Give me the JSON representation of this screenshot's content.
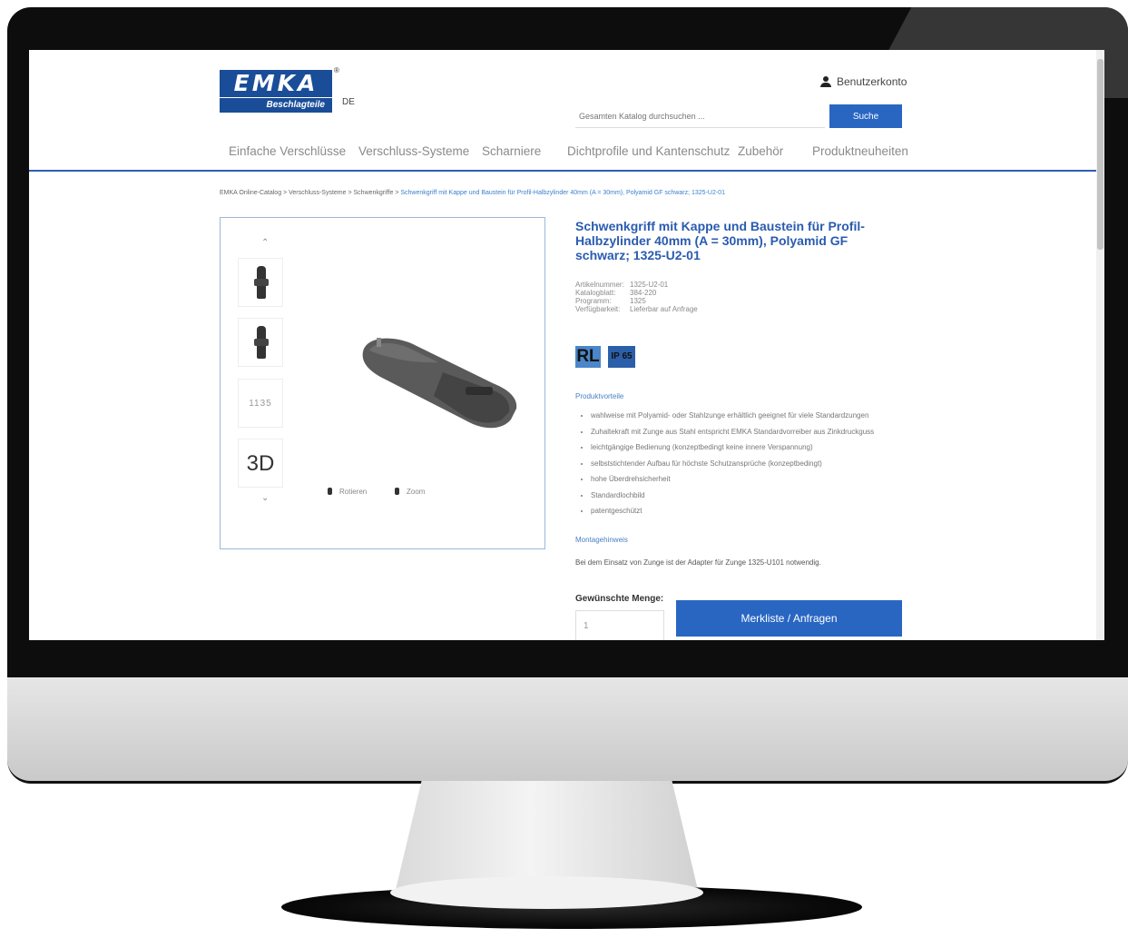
{
  "logo": {
    "brand": "EMKA",
    "tagline": "Beschlagteile",
    "registered": "®"
  },
  "lang": "DE",
  "account": {
    "label": "Benutzerkonto"
  },
  "search": {
    "placeholder": "Gesamten Katalog durchsuchen ...",
    "button": "Suche"
  },
  "nav": [
    "Einfache Verschlüsse",
    "Verschluss-Systeme",
    "Scharniere",
    "Dichtprofile und Kantenschutz",
    "Zubehör",
    "Produktneuheiten"
  ],
  "breadcrumb": {
    "items": [
      "EMKA Online-Catalog",
      "Verschluss-Systeme",
      "Schwenkgriffe"
    ],
    "separator": ">",
    "current": "Schwenkgriff mit Kappe und Baustein für Profil-Halbzylinder 40mm (A = 30mm), Polyamid GF schwarz; 1325-U2-01"
  },
  "gallery": {
    "up_arrow": "⌃",
    "down_arrow": "⌄",
    "thumb_3d": "3D",
    "thumb_dimensions": "1135",
    "rotate_label": "Rotieren",
    "zoom_label": "Zoom"
  },
  "product": {
    "title": "Schwenkgriff mit Kappe und Baustein für Profil-Halbzylinder 40mm (A = 30mm), Polyamid GF schwarz; 1325-U2-01",
    "details": [
      {
        "key": "Artikelnummer:",
        "value": "1325-U2-01"
      },
      {
        "key": "Katalogblatt:",
        "value": "384-220"
      },
      {
        "key": "Programm:",
        "value": "1325"
      },
      {
        "key": "Verfügbarkeit:",
        "value": "Lieferbar auf Anfrage"
      }
    ],
    "badges": {
      "rl": "RL",
      "ip": "IP 65"
    },
    "features_heading": "Produktvorteile",
    "features": [
      "wahlweise mit Polyamid- oder Stahlzunge erhältlich geeignet für viele Standardzungen",
      "Zuhaltekraft mit Zunge aus Stahl entspricht EMKA Standardvorreiber aus Zinkdruckguss",
      "leichtgängige Bedienung (konzeptbedingt keine innere Verspannung)",
      "selbststichtender Aufbau für höchste Schutzansprüche (konzeptbedingt)",
      "hohe Überdrehsicherheit",
      "Standardlochbild",
      "patentgeschützt"
    ],
    "mounting_heading": "Montagehinweis",
    "mounting_text": "Bei dem Einsatz von Zunge ist der Adapter für Zunge 1325-U101 notwendig.",
    "quantity_label": "Gewünschte Menge:",
    "quantity_value": "1",
    "add_button": "Merkliste / Anfragen"
  },
  "colors": {
    "accent": "#2866c2",
    "brand": "#1a4d98",
    "link": "#2a5bb0"
  }
}
